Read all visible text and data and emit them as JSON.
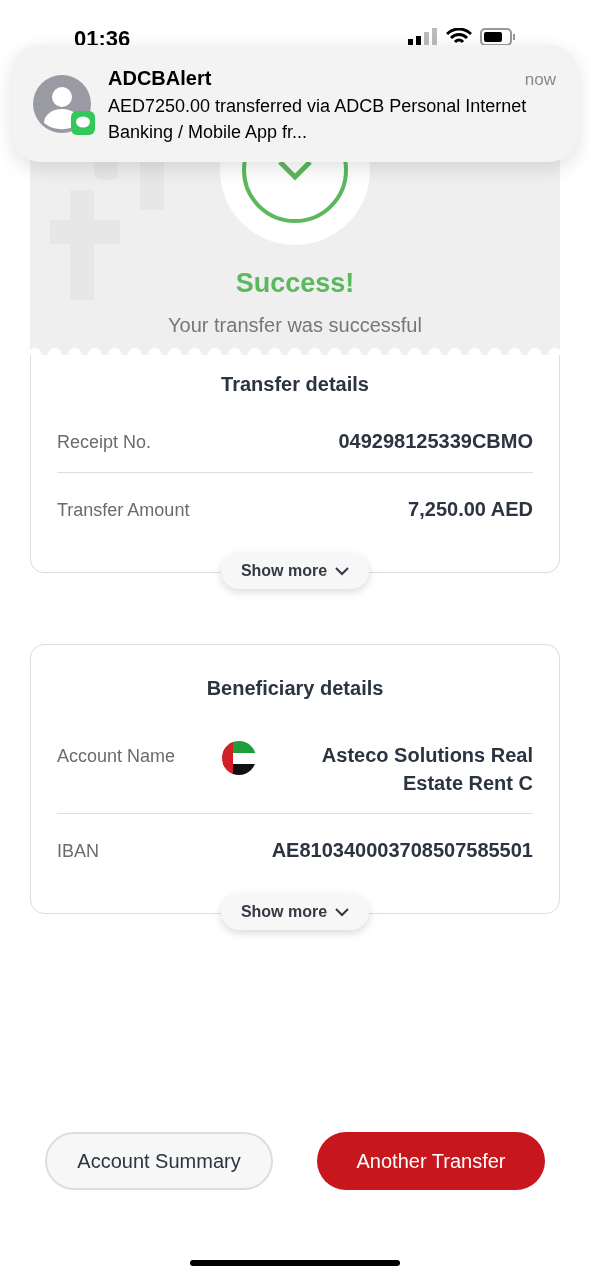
{
  "status_bar": {
    "time": "01:36"
  },
  "notification": {
    "app": "ADCBAlert",
    "time": "now",
    "message": "AED7250.00 transferred via ADCB Personal Internet Banking / Mobile App fr..."
  },
  "result": {
    "title": "Success!",
    "subtitle": "Your transfer was successful"
  },
  "sections": [
    {
      "title": "Transfer details",
      "rows": [
        {
          "label": "Receipt No.",
          "value": "049298125339CBMO",
          "flag": false
        },
        {
          "label": "Transfer Amount",
          "value": "7,250.00 AED",
          "flag": false
        }
      ],
      "show_more": "Show more"
    },
    {
      "title": "Beneficiary details",
      "rows": [
        {
          "label": "Account Name",
          "value": "Asteco Solutions Real Estate Rent C",
          "flag": true
        },
        {
          "label": "IBAN",
          "value": "AE810340003708507585501",
          "flag": false
        }
      ],
      "show_more": "Show more"
    }
  ],
  "buttons": [
    {
      "label": "Account Summary",
      "kind": "secondary"
    },
    {
      "label": "Another Transfer",
      "kind": "primary"
    }
  ]
}
